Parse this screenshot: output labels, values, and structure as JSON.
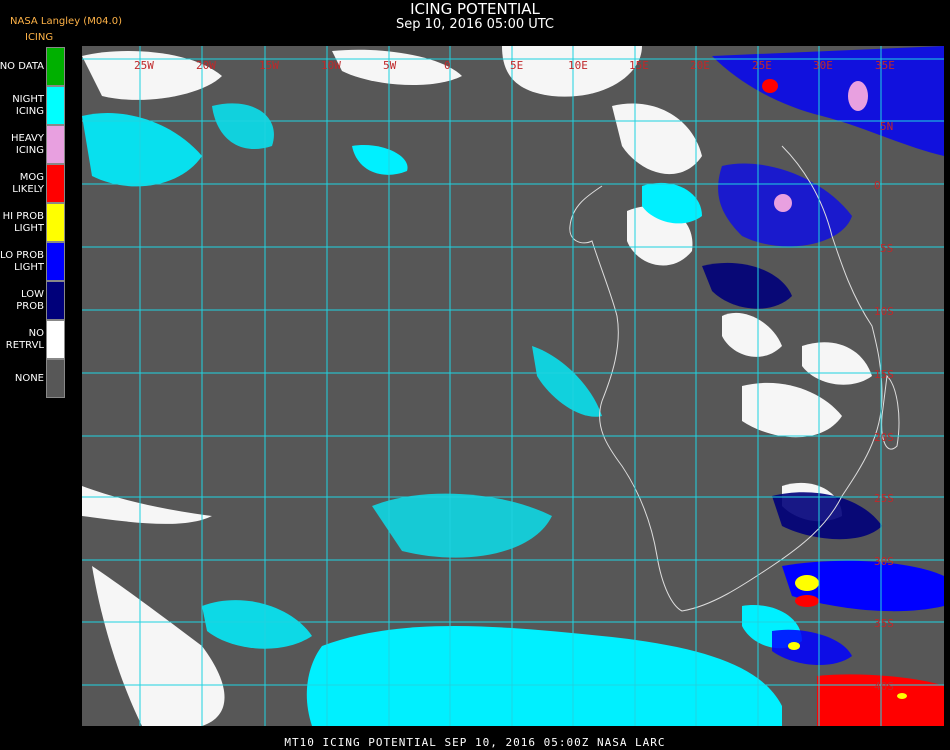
{
  "header": {
    "title": "ICING POTENTIAL",
    "subtitle": "Sep 10, 2016 05:00 UTC",
    "source": "NASA Langley (M04.0)"
  },
  "legend": {
    "title": "ICING",
    "items": [
      {
        "label": "NO DATA",
        "color": "#00b000"
      },
      {
        "label": "NIGHT\nICING",
        "color": "#00ffff"
      },
      {
        "label": "HEAVY\nICING",
        "color": "#e8a0e0"
      },
      {
        "label": "MOG\nLIKELY",
        "color": "#ff0000"
      },
      {
        "label": "HI PROB\nLIGHT",
        "color": "#ffff00"
      },
      {
        "label": "LO PROB\nLIGHT",
        "color": "#0000ff"
      },
      {
        "label": "LOW\nPROB",
        "color": "#00007a"
      },
      {
        "label": "NO\nRETRVL",
        "color": "#ffffff"
      },
      {
        "label": "NONE",
        "color": "#575757"
      }
    ]
  },
  "map": {
    "longitude_labels": [
      "25W",
      "20W",
      "15W",
      "10W",
      "5W",
      "0",
      "5E",
      "10E",
      "15E",
      "20E",
      "25E",
      "30E",
      "35E"
    ],
    "latitude_labels": [
      "5N",
      "0",
      "5S",
      "10S",
      "15S",
      "20S",
      "25S",
      "30S",
      "35S",
      "40S"
    ],
    "colors": {
      "background": "#575757",
      "grid": "#1fd3e0",
      "coast": "#e0e0e0",
      "labels": "#c0282a"
    }
  },
  "footer": {
    "text": "MT10  ICING POTENTIAL   SEP 10, 2016 05:00Z   NASA LARC"
  }
}
